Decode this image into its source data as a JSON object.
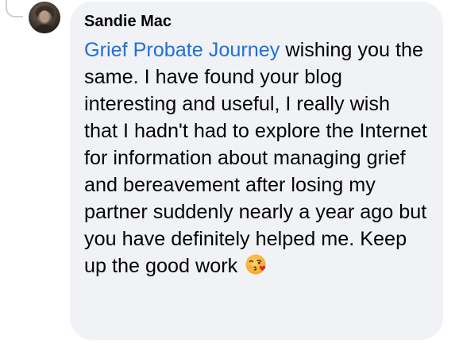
{
  "comment": {
    "author": "Sandie Mac",
    "mention": "Grief Probate Journey",
    "body": " wishing you the same. I have found your blog interesting and useful, I really wish that I hadn't had to explore the Internet for information about managing grief and bereavement after losing my partner suddenly nearly a year ago but you have definitely helped me. Keep up the good work ",
    "emoji": "face-blowing-a-kiss-icon"
  },
  "colors": {
    "bubble": "#f0f2f5",
    "mention": "#216fdb",
    "text": "#050505"
  }
}
